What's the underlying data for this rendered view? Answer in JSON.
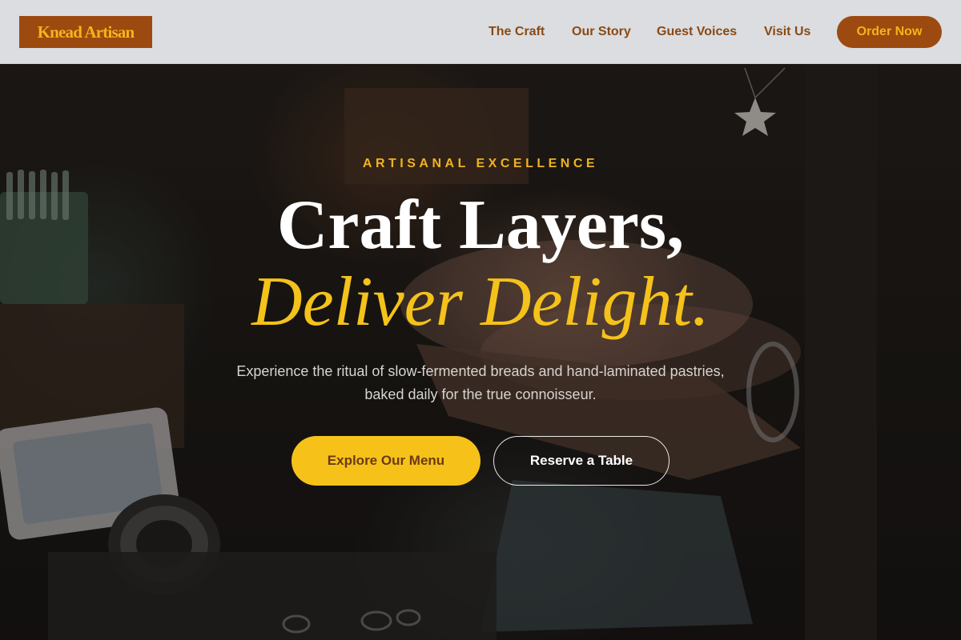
{
  "brand": {
    "name": "Knead Artisan"
  },
  "nav": {
    "links": [
      "The Craft",
      "Our Story",
      "Guest Voices",
      "Visit Us"
    ],
    "cta_label": "Order Now"
  },
  "hero": {
    "eyebrow": "ARTISANAL EXCELLENCE",
    "headline_line1": "Craft Layers,",
    "headline_line2": "Deliver Delight.",
    "subtext": "Experience the ritual of slow-fermented breads and hand-laminated pastries, baked daily for the true connoisseur.",
    "primary_button": "Explore Our Menu",
    "secondary_button": "Reserve a Table",
    "background_image": "workshop-hands-photo"
  },
  "colors": {
    "brand_brown": "#9c4a10",
    "accent_gold": "#f6c21a",
    "header_bg": "#e2e4e7"
  }
}
